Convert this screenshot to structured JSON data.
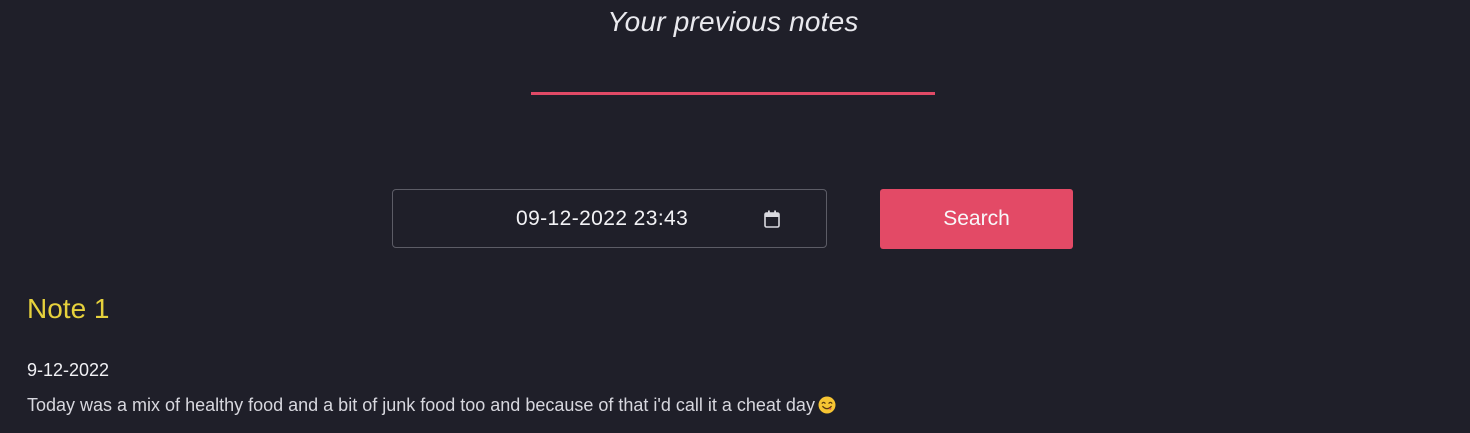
{
  "header": {
    "title": "Your previous notes"
  },
  "search": {
    "date_value": "09-12-2022  23:43",
    "button_label": "Search"
  },
  "notes": [
    {
      "title": "Note 1",
      "date": "9-12-2022",
      "body": "Today was a mix of healthy food and a bit of junk food too and because of that i'd call it a cheat day",
      "emoji": "face-savoring-food-emoji"
    }
  ],
  "colors": {
    "background": "#1f1f29",
    "accent": "#e34a66",
    "note_title": "#e6d13c"
  }
}
